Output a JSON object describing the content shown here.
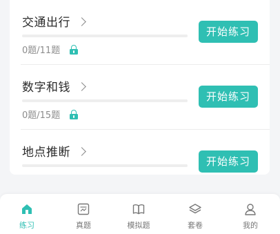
{
  "colors": {
    "accent": "#2fbfb3",
    "title_text": "#2b2b2b",
    "meta_text": "#8c8c8c",
    "tab_text": "#777777",
    "background": "#f4f5f7"
  },
  "lessons": [
    {
      "title": "交通出行",
      "progress_text": "0题/11题",
      "progress": 0,
      "locked": true,
      "button_label": "开始练习"
    },
    {
      "title": "数字和钱",
      "progress_text": "0题/15题",
      "progress": 0,
      "locked": true,
      "button_label": "开始练习"
    },
    {
      "title": "地点推断",
      "button_label": "开始练习"
    }
  ],
  "tabbar": {
    "items": [
      {
        "label": "练习",
        "icon": "home-icon",
        "active": true
      },
      {
        "label": "真题",
        "icon": "exam-paper-icon",
        "active": false
      },
      {
        "label": "模拟题",
        "icon": "open-book-icon",
        "active": false
      },
      {
        "label": "套卷",
        "icon": "layers-icon",
        "active": false
      },
      {
        "label": "我的",
        "icon": "person-icon",
        "active": false
      }
    ]
  }
}
